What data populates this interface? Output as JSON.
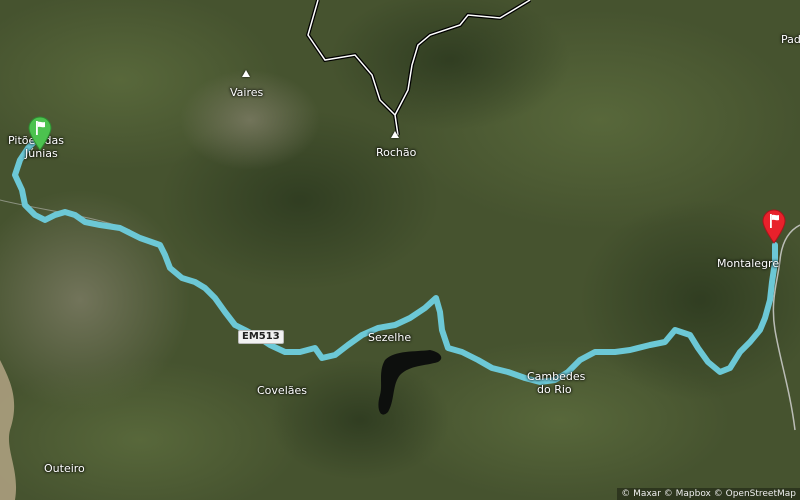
{
  "places": [
    {
      "id": "pitoes",
      "lines": [
        "Pitões das",
        "Júnias"
      ]
    },
    {
      "id": "vaires",
      "lines": [
        "Vaires"
      ]
    },
    {
      "id": "rochao",
      "lines": [
        "Rochão"
      ]
    },
    {
      "id": "sezelhe",
      "lines": [
        "Sezelhe"
      ]
    },
    {
      "id": "covelaes",
      "lines": [
        "Covelães"
      ]
    },
    {
      "id": "cambedes",
      "lines": [
        "Cambedes",
        "do Rio"
      ]
    },
    {
      "id": "outeiro",
      "lines": [
        "Outeiro"
      ]
    },
    {
      "id": "montalegre",
      "lines": [
        "Montalegre"
      ]
    },
    {
      "id": "padroso",
      "lines": [
        "Pad"
      ]
    }
  ],
  "road_shield": {
    "label": "EM513"
  },
  "markers": {
    "start": {
      "label": "start",
      "color": "#4cc24f",
      "icon": "flag-icon"
    },
    "end": {
      "label": "end",
      "color": "#e8212b",
      "icon": "flag-icon"
    }
  },
  "route": {
    "color": "#6cc8d6"
  },
  "attribution": "© Maxar © Mapbox © OpenStreetMap"
}
